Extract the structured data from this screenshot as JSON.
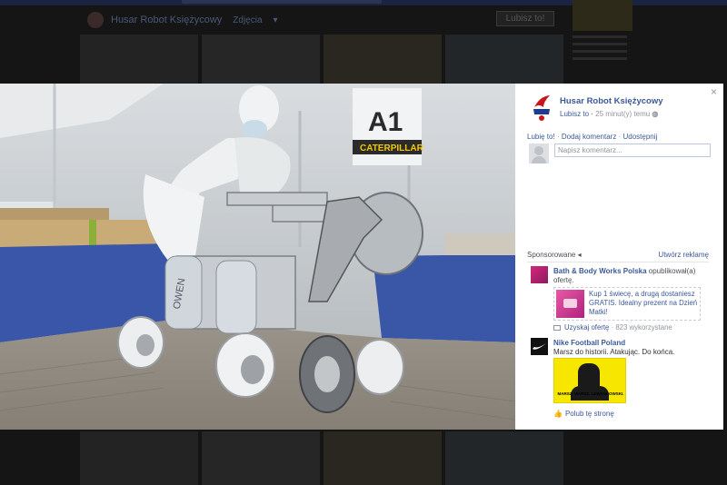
{
  "background_page": {
    "page_name": "Husar Robot Księżycowy",
    "tab_label": "Zdjęcia",
    "like_button": "Lubisz to!"
  },
  "theater": {
    "close_icon": "close-icon",
    "post": {
      "author": "Husar Robot Księżycowy",
      "meta_prefix": "Lubisz to",
      "meta_time": "25 minut(y) temu",
      "audience_icon": "globe-icon"
    },
    "actions": {
      "like": "Lubię to!",
      "comment": "Dodaj komentarz",
      "share": "Udostępnij",
      "separator": "·"
    },
    "comment_placeholder": "Napisz komentarz...",
    "sponsored": {
      "label": "Sponsorowane",
      "create_ad": "Utwórz reklamę"
    },
    "ads": [
      {
        "brand": "Bath & Body Works Polska",
        "action": "opublikował(a) ofertę.",
        "offer_text": "Kup 1 świecę, a drugą dostaniesz GRATIS. Idealny prezent na Dzień Matki!",
        "claim_link": "Uzyskaj ofertę",
        "claim_count": "823 wykorzystane"
      },
      {
        "brand": "Nike Football Poland",
        "tagline": "Marsz do historii. Atakując. Do końca.",
        "image_caption": "MARSZ. MARSZ. LEWANDOWSKI.",
        "like_page": "Polub tę stronę"
      }
    ]
  },
  "photo": {
    "sign_text": "A1",
    "sign_subtext": "CATERPILLAR",
    "bottle_label": "OWEN"
  },
  "colors": {
    "link": "#3b5998",
    "overlay": "#151515",
    "sidebar_bg": "#ffffff"
  }
}
